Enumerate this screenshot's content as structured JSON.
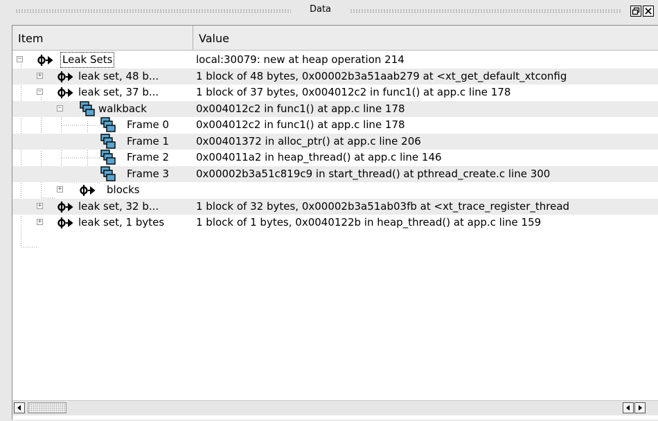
{
  "window": {
    "title": "Data",
    "float_icon": "float-window-icon",
    "close_icon": "close-icon"
  },
  "columns": {
    "item": "Item",
    "value": "Value"
  },
  "rows": [
    {
      "label": "Leak Sets",
      "value": "local:30079: new at heap operation 214",
      "icon": "leak-icon",
      "expander": "−"
    },
    {
      "label": "leak set, 48 b...",
      "value": "1 block of 48 bytes, 0x00002b3a51aab279 at <xt_get_default_xtconfig",
      "icon": "leak-icon",
      "expander": "+"
    },
    {
      "label": "leak set, 37 b...",
      "value": "1 block of 37 bytes, 0x004012c2 in func1() at app.c line 178",
      "icon": "leak-icon",
      "expander": "−"
    },
    {
      "label": "walkback",
      "value": "0x004012c2 in func1() at app.c line 178",
      "icon": "stack-icon",
      "expander": "−"
    },
    {
      "label": "Frame 0",
      "value": "0x004012c2 in func1() at app.c line 178",
      "icon": "stack-icon"
    },
    {
      "label": "Frame 1",
      "value": "0x00401372 in alloc_ptr() at app.c line 206",
      "icon": "stack-icon"
    },
    {
      "label": "Frame 2",
      "value": "0x004011a2 in heap_thread() at app.c line 146",
      "icon": "stack-icon"
    },
    {
      "label": "Frame 3",
      "value": "0x00002b3a51c819c9 in start_thread() at pthread_create.c line 300",
      "icon": "stack-icon"
    },
    {
      "label": "blocks",
      "value": "",
      "icon": "leak-icon",
      "expander": "+"
    },
    {
      "label": "leak set, 32 b...",
      "value": "1 block of 32 bytes, 0x00002b3a51ab03fb at <xt_trace_register_thread",
      "icon": "leak-icon",
      "expander": "+"
    },
    {
      "label": "leak set, 1 bytes",
      "value": "1 block of 1 bytes, 0x0040122b in heap_thread() at app.c line 159",
      "icon": "leak-icon",
      "expander": "+"
    }
  ],
  "scrollbar": {
    "left_icon": "arrow-left-icon",
    "right_icon": "arrow-right-icon"
  },
  "colors": {
    "stack_icon_fill": "#5aa5d0",
    "alt_row": "#ebebeb"
  }
}
